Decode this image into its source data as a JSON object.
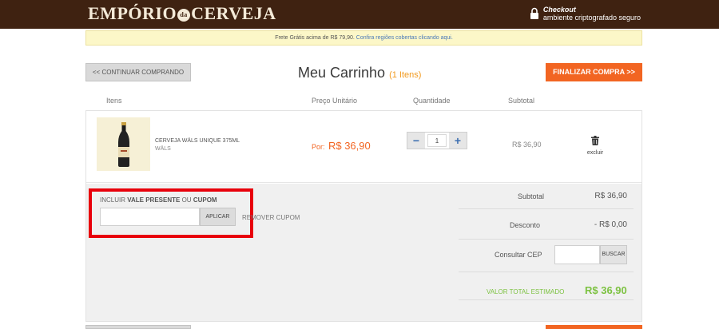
{
  "header": {
    "logo_left": "EMPÓRIO",
    "logo_mid": "da",
    "logo_right": "CERVEJA",
    "checkout_title": "Checkout",
    "checkout_subtitle": "ambiente criptografado seguro"
  },
  "banner": {
    "text": "Frete Grátis acima de R$ 79,90.",
    "link": "Confira regiões cobertas clicando aqui."
  },
  "toolbar": {
    "continue_label": "<< CONTINUAR COMPRANDO",
    "title": "Meu Carrinho",
    "count": "(1 Itens)",
    "finish_label": "FINALIZAR COMPRA >>"
  },
  "table_headers": [
    "Itens",
    "Preço Unitário",
    "Quantidade",
    "Subtotal"
  ],
  "cart_item": {
    "name": "CERVEJA WÄLS UNIQUE 375ML",
    "brand": "WÄLS",
    "price_prefix": "Por:",
    "price": "R$ 36,90",
    "quantity": "1",
    "minus": "−",
    "plus": "+",
    "subtotal": "R$ 36,90",
    "delete_label": "excluir"
  },
  "coupon": {
    "label_prefix": "INCLUIR",
    "label_bold1": "VALE PRESENTE",
    "label_or": "OU",
    "label_bold2": "CUPOM",
    "input_value": "",
    "apply_label": "APLICAR",
    "remove_label": "REMOVER CUPOM"
  },
  "summary": {
    "subtotal_label": "Subtotal",
    "subtotal_value": "R$ 36,90",
    "discount_label": "Desconto",
    "discount_value": "- R$ 0,00",
    "cep_label": "Consultar CEP",
    "cep_value": "",
    "cep_button": "BUSCAR",
    "total_label": "VALOR TOTAL ESTIMADO",
    "total_value": "R$ 36,90"
  },
  "colors": {
    "header_bg": "#3f2211",
    "accent_orange": "#f26522",
    "total_green": "#7dc242",
    "highlight_red": "#e8000b"
  }
}
